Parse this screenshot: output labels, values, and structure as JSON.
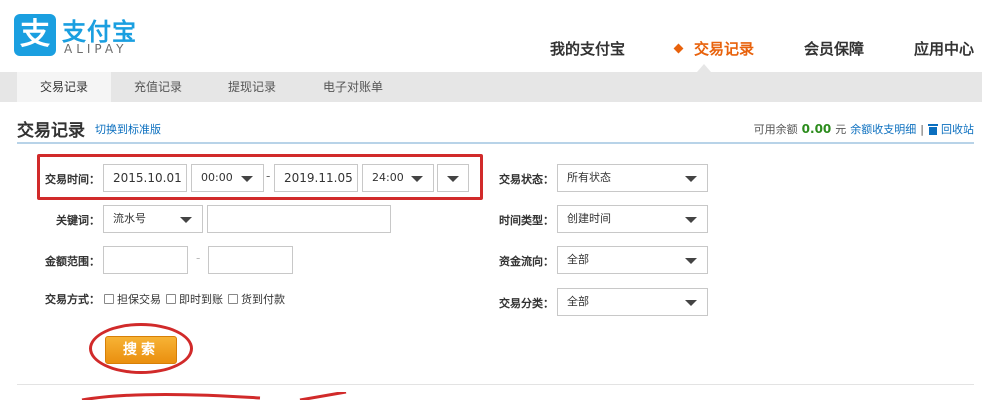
{
  "header": {
    "logo_cn": "支付宝",
    "logo_en": "ALIPAY",
    "logo_mark": "支",
    "nav": [
      {
        "label": "我的支付宝",
        "active": false
      },
      {
        "label": "交易记录",
        "active": true
      },
      {
        "label": "会员保障",
        "active": false
      },
      {
        "label": "应用中心",
        "active": false
      }
    ]
  },
  "subnav": {
    "items": [
      {
        "label": "交易记录",
        "active": true
      },
      {
        "label": "充值记录",
        "active": false
      },
      {
        "label": "提现记录",
        "active": false
      },
      {
        "label": "电子对账单",
        "active": false
      }
    ]
  },
  "title_row": {
    "title": "交易记录",
    "switch_link": "切换到标准版",
    "balance_label": "可用余额",
    "balance_amount": "0.00",
    "balance_unit": "元",
    "detail_link": "余额收支明细",
    "separator": "|",
    "recycle_link": "回收站"
  },
  "filters": {
    "trade_time": {
      "label": "交易时间：",
      "start_date": "2015.10.01",
      "start_time": "00:00",
      "dash": "-",
      "end_date": "2019.11.05",
      "end_time": "24:00"
    },
    "keyword": {
      "label": "关键词：",
      "type": "流水号",
      "value": ""
    },
    "amount_range": {
      "label": "金额范围：",
      "min": "",
      "dash": "-",
      "max": ""
    },
    "trade_method": {
      "label": "交易方式：",
      "options": [
        {
          "label": "担保交易",
          "checked": false
        },
        {
          "label": "即时到账",
          "checked": false
        },
        {
          "label": "货到付款",
          "checked": false
        }
      ]
    },
    "trade_status": {
      "label": "交易状态：",
      "value": "所有状态"
    },
    "time_type": {
      "label": "时间类型：",
      "value": "创建时间"
    },
    "fund_flow": {
      "label": "资金流向：",
      "value": "全部"
    },
    "trade_category": {
      "label": "交易分类：",
      "value": "全部"
    }
  },
  "search_button": "搜索",
  "colors": {
    "brand_blue": "#1a9fe0",
    "active_orange": "#e8620c",
    "link_blue": "#0b6fbf",
    "balance_green": "#2c8c1d",
    "annotation_red": "#d12a2a",
    "button_orange": "#ea8f0f"
  }
}
